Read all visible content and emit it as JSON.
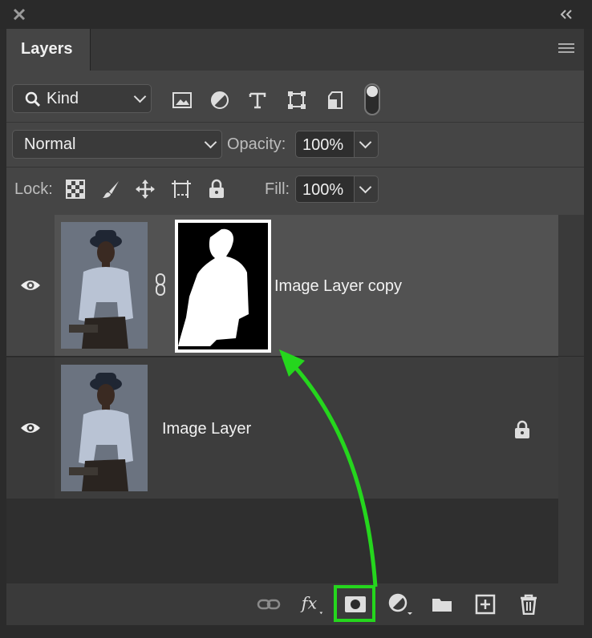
{
  "panel": {
    "title": "Layers"
  },
  "filter": {
    "kind_label": "Kind"
  },
  "blend": {
    "mode": "Normal",
    "opacity_label": "Opacity:",
    "opacity_value": "100%",
    "lock_label": "Lock:",
    "fill_label": "Fill:",
    "fill_value": "100%"
  },
  "layers": [
    {
      "name": "Image Layer copy",
      "visible": true,
      "selected": true,
      "has_mask": true,
      "locked": false
    },
    {
      "name": "Image Layer",
      "visible": true,
      "selected": false,
      "has_mask": false,
      "locked": true
    }
  ],
  "colors": {
    "highlight": "#25d61d",
    "arrow": "#25d61d",
    "selected_row": "#525252"
  },
  "icons": {
    "filters": [
      "image-filter-icon",
      "adjustment-filter-icon",
      "type-filter-icon",
      "shape-filter-icon",
      "smart-object-filter-icon",
      "filter-toggle-icon"
    ],
    "locks": [
      "lock-transparency-icon",
      "lock-image-pixels-icon",
      "lock-position-icon",
      "lock-artboard-icon",
      "lock-all-icon"
    ],
    "bottom": [
      "link-layers-icon",
      "fx-icon",
      "add-mask-icon",
      "adjustment-layer-icon",
      "new-group-icon",
      "new-layer-icon",
      "delete-icon"
    ]
  }
}
